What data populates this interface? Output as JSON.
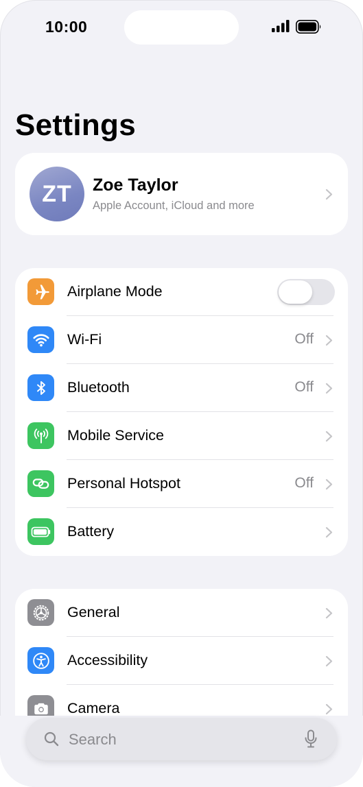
{
  "status_bar": {
    "time": "10:00"
  },
  "header": {
    "title": "Settings"
  },
  "profile": {
    "initials": "ZT",
    "name": "Zoe Taylor",
    "subtitle": "Apple Account, iCloud and more"
  },
  "group1": {
    "airplane": {
      "label": "Airplane Mode",
      "enabled": false,
      "icon": "airplane-icon",
      "color": "#F29A38"
    },
    "wifi": {
      "label": "Wi-Fi",
      "value": "Off",
      "icon": "wifi-icon",
      "color": "#2F88F7"
    },
    "bluetooth": {
      "label": "Bluetooth",
      "value": "Off",
      "icon": "bluetooth-icon",
      "color": "#2F88F7"
    },
    "mobile": {
      "label": "Mobile Service",
      "icon": "antenna-icon",
      "color": "#3DC560"
    },
    "hotspot": {
      "label": "Personal Hotspot",
      "value": "Off",
      "icon": "hotspot-link-icon",
      "color": "#3DC560"
    },
    "battery": {
      "label": "Battery",
      "icon": "battery-icon",
      "color": "#3DC560"
    }
  },
  "group2": {
    "general": {
      "label": "General",
      "icon": "gear-icon",
      "color": "#8E8E93"
    },
    "accessibility": {
      "label": "Accessibility",
      "icon": "accessibility-icon",
      "color": "#2F88F7"
    },
    "camera": {
      "label": "Camera",
      "icon": "camera-icon",
      "color": "#8E8E93"
    }
  },
  "search": {
    "placeholder": "Search"
  }
}
